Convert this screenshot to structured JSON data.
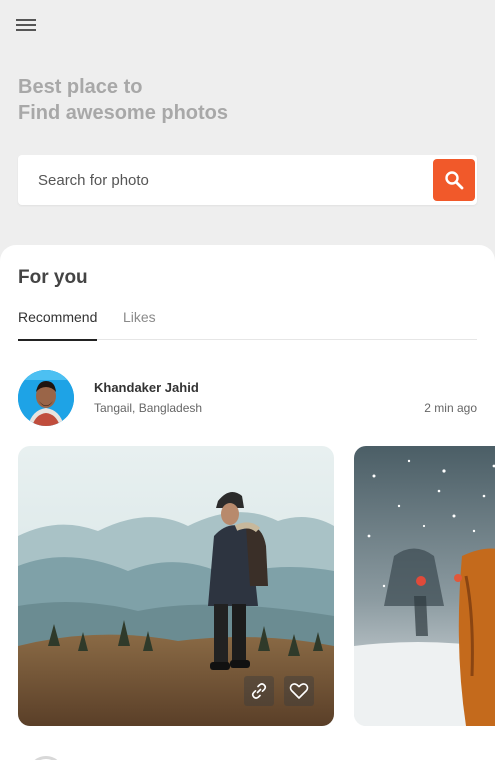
{
  "header": {
    "menu_icon": "menu-icon",
    "headline_line1": "Best place to",
    "headline_line2": "Find awesome photos"
  },
  "search": {
    "placeholder": "Search for photo",
    "value": "",
    "button_icon": "search-icon",
    "accent_color": "#f1592a"
  },
  "feed": {
    "section_title": "For you",
    "tabs": [
      {
        "label": "Recommend",
        "active": true
      },
      {
        "label": "Likes",
        "active": false
      }
    ],
    "post": {
      "author_name": "Khandaker Jahid",
      "location": "Tangail, Bangladesh",
      "time": "2 min ago",
      "photos": [
        {
          "description": "hiker-in-mountains",
          "actions": [
            "link-icon",
            "heart-icon"
          ]
        },
        {
          "description": "person-in-snow"
        }
      ]
    }
  }
}
